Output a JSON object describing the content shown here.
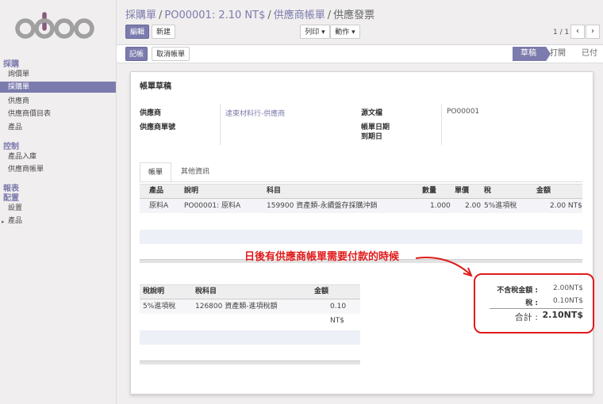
{
  "app": {
    "logo_text": "odoo"
  },
  "sidebar": {
    "sections": [
      {
        "label": "採購",
        "items": [
          "詢價單",
          "採購單",
          "供應商",
          "供應商價目表",
          "產品"
        ]
      },
      {
        "label": "控制",
        "items": [
          "產品入庫",
          "供應商帳單"
        ]
      },
      {
        "label": "報表",
        "items": []
      },
      {
        "label": "配置",
        "items": [
          "設置",
          "產品"
        ]
      }
    ],
    "active_item": "採購單"
  },
  "breadcrumb": {
    "part1": "採購單",
    "part2": "PO00001: 2.10 NT$",
    "part3": "供應商帳單",
    "current": "供應發票",
    "sep": "/"
  },
  "toolbar": {
    "edit": "編輯",
    "create": "新建",
    "print": "列印 ▾",
    "action": "動作 ▾",
    "pager": "1 / 1",
    "prev": "‹",
    "next": "›"
  },
  "statusbar": {
    "post": "記帳",
    "cancel": "取消帳單",
    "stages": [
      "草稿",
      "打開",
      "已付"
    ],
    "active_stage": "草稿"
  },
  "form": {
    "title": "帳單草稿",
    "vendor_label": "供應商",
    "vendor_value": "達東材料行-供應商",
    "vendor_ref_label": "供應商單號",
    "source_label": "源文檔",
    "source_value": "PO00001",
    "bill_date_label": "帳單日期",
    "due_date_label": "到期日"
  },
  "tabs": [
    "帳單",
    "其他資訊"
  ],
  "lines_table": {
    "headers": [
      "產品",
      "說明",
      "科目",
      "數量",
      "單價",
      "稅",
      "金額"
    ],
    "rows": [
      [
        "原料A",
        "PO00001: 原料A",
        "159900 資產類-永續盤存採購沖銷",
        "1.000",
        "2.00",
        "5%進項稅",
        "2.00 NT$"
      ]
    ]
  },
  "tax_table": {
    "headers": [
      "稅說明",
      "稅科目",
      "金額"
    ],
    "rows": [
      [
        "5%進項稅",
        "126800 資產類-進項稅額",
        "0.10 NT$"
      ]
    ]
  },
  "totals": {
    "untaxed_label": "不含稅金額 :",
    "untaxed_value": "2.00NT$",
    "tax_label": "稅 :",
    "tax_value": "0.10NT$",
    "total_label": "合計 :",
    "total_value": "2.10NT$"
  },
  "annotation": {
    "text": "日後有供應商帳單需要付款的時候",
    "color": "#e01b1b"
  },
  "colors": {
    "brand": "#7c7bad",
    "annotation": "#e01b1b"
  }
}
